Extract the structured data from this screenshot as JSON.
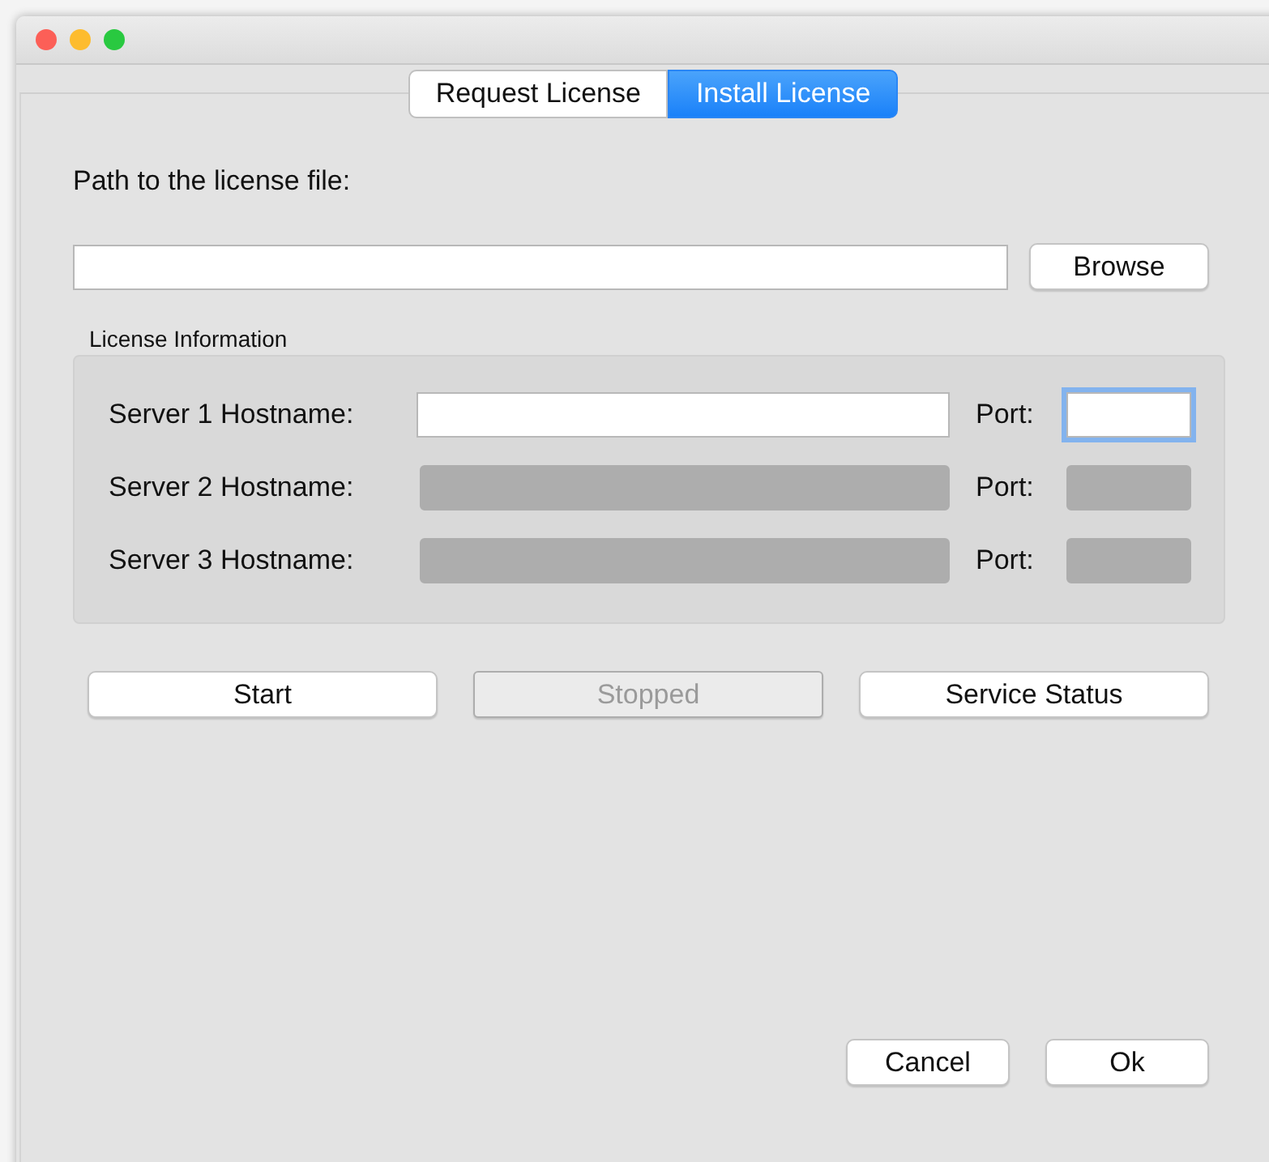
{
  "tabs": [
    {
      "label": "Request License",
      "selected": false
    },
    {
      "label": "Install License",
      "selected": true
    }
  ],
  "path": {
    "label": "Path to the license file:",
    "browse_button": "Browse"
  },
  "license_information": {
    "title": "License Information",
    "servers": [
      {
        "label": "Server 1 Hostname:",
        "port_label": "Port:",
        "disabled": false,
        "port_focused": true
      },
      {
        "label": "Server 2 Hostname:",
        "port_label": "Port:",
        "disabled": true,
        "port_focused": false
      },
      {
        "label": "Server 3 Hostname:",
        "port_label": "Port:",
        "disabled": true,
        "port_focused": false
      }
    ]
  },
  "service_buttons": [
    {
      "label": "Start",
      "disabled": false
    },
    {
      "label": "Stopped",
      "disabled": true
    },
    {
      "label": "Service Status",
      "disabled": false
    }
  ],
  "dialog_buttons": [
    "Cancel",
    "Ok"
  ]
}
